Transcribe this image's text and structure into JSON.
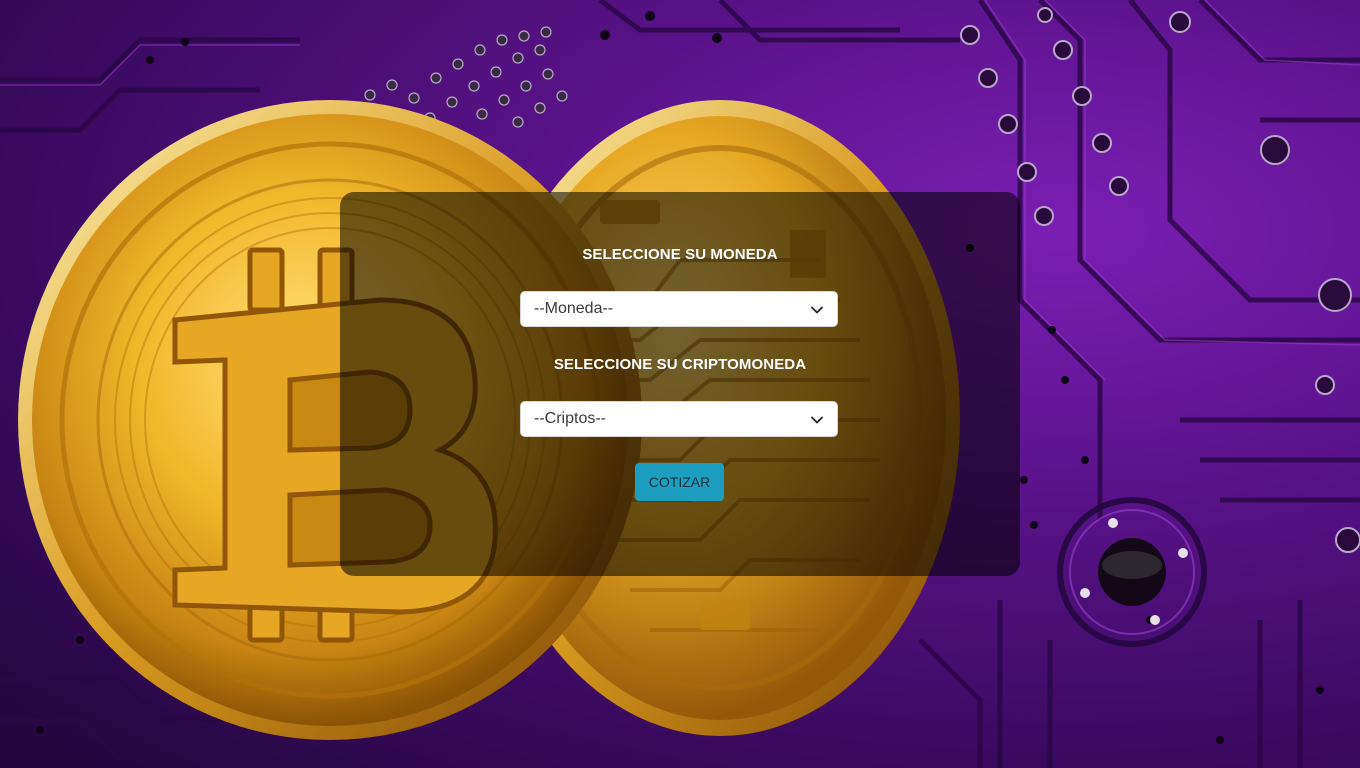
{
  "form": {
    "currency_label": "SELECCIONE SU MONEDA",
    "currency_select": {
      "selected": "--Moneda--"
    },
    "crypto_label": "SELECCIONE SU CRIPTOMONEDA",
    "crypto_select": {
      "selected": "--Criptos--"
    },
    "submit_label": "COTIZAR"
  },
  "icons": {
    "dropdown": "chevron-down-icon"
  },
  "colors": {
    "card_overlay": "rgba(0,0,0,0.55)",
    "button": "#1c9fbf",
    "background_purple": "#5a128a",
    "coin_gold": "#e3a91f"
  }
}
